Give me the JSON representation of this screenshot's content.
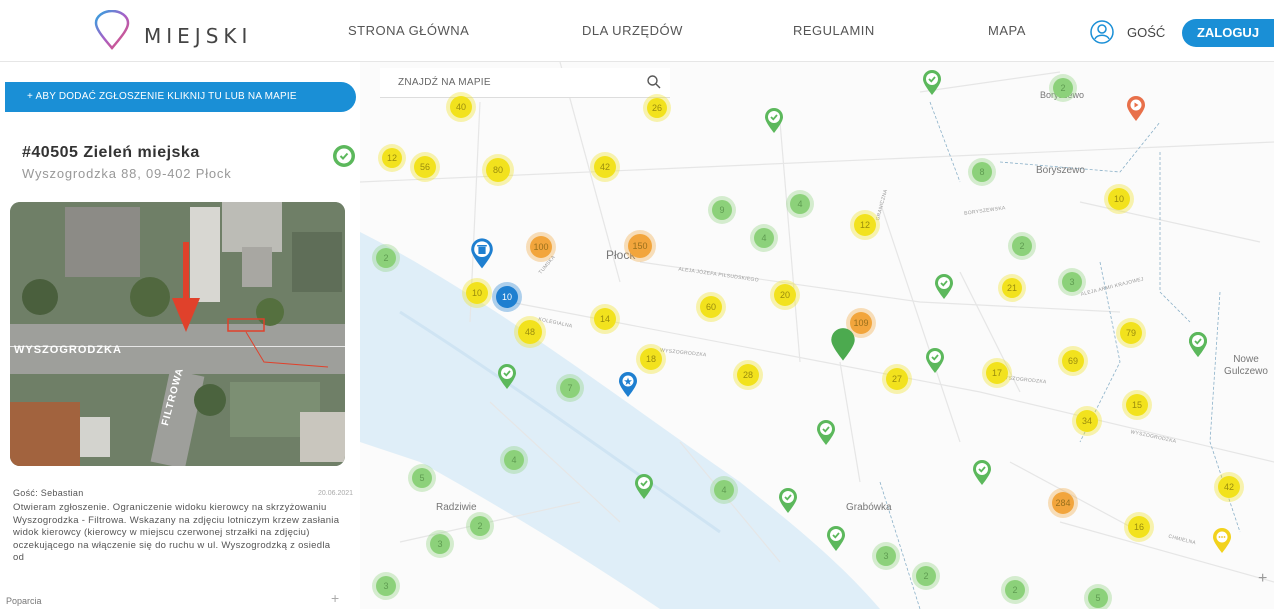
{
  "header": {
    "logo_text": "MIEJSKI",
    "nav": {
      "home": "STRONA GŁÓWNA",
      "offices": "DLA URZĘDÓW",
      "rules": "REGULAMIN",
      "map": "MAPA"
    },
    "user_label": "GOŚĆ",
    "login_label": "ZALOGUJ"
  },
  "sidebar": {
    "add_button_label": "+ ABY DODAĆ ZGŁOSZENIE KLIKNIJ TU LUB NA MAPIE",
    "report": {
      "title": "#40505 Zieleń miejska",
      "address": "Wyszogrodzka 88, 09-402 Płock",
      "status": "resolved",
      "photo_street_label": "WYSZOGRODZKA",
      "photo_cross_label": "FILTROWA",
      "author": "Gość: Sebastian",
      "date": "20.06.2021",
      "description": "Otwieram zgłoszenie. Ograniczenie widoku kierowcy na skrzyżowaniu Wyszogrodzka - Filtrowa. Wskazany na zdjęciu lotniczym krzew zasłania widok kierowcy (kierowcy w miejscu czerwonej strzałki na zdjęciu) oczekującego na włączenie się do ruchu w ul. Wyszogrodzką z osiedla od"
    },
    "support_label": "Poparcia",
    "support_toggle": "+"
  },
  "map": {
    "search_placeholder": "ZNAJDŹ NA MAPIE",
    "zoom_in": "+",
    "place_labels": {
      "plock": "Płock",
      "boryszewo_1": "Boryszewo",
      "boryszewo_2": "Boryszewo",
      "nowe_gulczewo": "Nowe Gulczewo",
      "radziwie": "Radziwie",
      "grabowka": "Grabówka"
    },
    "street_labels": {
      "wyszogrodzka_1": "WYSZOGRODZKA",
      "wyszogrodzka_2": "WYSZOGRODZKA",
      "wyszogrodzka_3": "WYSZOGRODZKA",
      "aleja_jozefa": "ALEJA JÓZEFA PIŁSUDSKIEGO",
      "kolegialna": "KOLEGIALNA",
      "tumska": "TUMSKA",
      "graniczna": "GRANICZNA",
      "chmielna": "CHMIELNA",
      "krajowej": "ALEJA ARMII KRAJOWEJ",
      "boryszewska": "BORYSZEWSKA"
    },
    "clusters": [
      {
        "label": "40",
        "color": "yellow"
      },
      {
        "label": "26",
        "color": "yellow"
      },
      {
        "label": "12",
        "color": "yellow"
      },
      {
        "label": "56",
        "color": "yellow"
      },
      {
        "label": "80",
        "color": "yellow"
      },
      {
        "label": "42",
        "color": "yellow"
      },
      {
        "label": "2",
        "color": "green"
      },
      {
        "label": "8",
        "color": "green"
      },
      {
        "label": "9",
        "color": "green"
      },
      {
        "label": "4",
        "color": "green"
      },
      {
        "label": "4",
        "color": "green"
      },
      {
        "label": "12",
        "color": "yellow"
      },
      {
        "label": "10",
        "color": "yellow"
      },
      {
        "label": "2",
        "color": "green"
      },
      {
        "label": "100",
        "color": "orange"
      },
      {
        "label": "150",
        "color": "orange"
      },
      {
        "label": "2",
        "color": "green"
      },
      {
        "label": "10",
        "color": "yellow"
      },
      {
        "label": "10",
        "color": "blue"
      },
      {
        "label": "60",
        "color": "yellow"
      },
      {
        "label": "20",
        "color": "yellow"
      },
      {
        "label": "21",
        "color": "yellow"
      },
      {
        "label": "3",
        "color": "green"
      },
      {
        "label": "48",
        "color": "yellow"
      },
      {
        "label": "14",
        "color": "yellow"
      },
      {
        "label": "109",
        "color": "orange"
      },
      {
        "label": "79",
        "color": "yellow"
      },
      {
        "label": "18",
        "color": "yellow"
      },
      {
        "label": "69",
        "color": "yellow"
      },
      {
        "label": "28",
        "color": "yellow"
      },
      {
        "label": "27",
        "color": "yellow"
      },
      {
        "label": "17",
        "color": "yellow"
      },
      {
        "label": "7",
        "color": "green"
      },
      {
        "label": "15",
        "color": "yellow"
      },
      {
        "label": "34",
        "color": "yellow"
      },
      {
        "label": "4",
        "color": "green"
      },
      {
        "label": "5",
        "color": "green"
      },
      {
        "label": "4",
        "color": "green"
      },
      {
        "label": "42",
        "color": "yellow"
      },
      {
        "label": "284",
        "color": "orange"
      },
      {
        "label": "2",
        "color": "green"
      },
      {
        "label": "16",
        "color": "yellow"
      },
      {
        "label": "3",
        "color": "green"
      },
      {
        "label": "3",
        "color": "green"
      },
      {
        "label": "3",
        "color": "green"
      },
      {
        "label": "2",
        "color": "green"
      },
      {
        "label": "2",
        "color": "green"
      },
      {
        "label": "5",
        "color": "green"
      }
    ]
  },
  "colors": {
    "accent": "#1a8fd6",
    "resolved": "#5cb85c",
    "cluster_yellow": "#f2e21d",
    "cluster_green": "#8cd17a",
    "cluster_orange": "#f2a53c"
  }
}
